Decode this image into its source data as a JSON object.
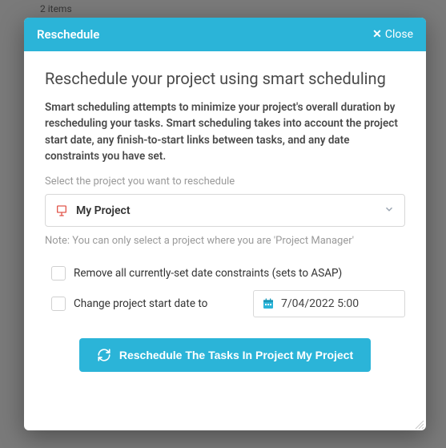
{
  "background": {
    "items_text": "2 items"
  },
  "modal": {
    "header_title": "Reschedule",
    "close_label": "Close",
    "title": "Reschedule your project using smart scheduling",
    "description": "Smart scheduling attempts to minimize your project's overall duration by rescheduling your tasks. Smart scheduling takes into account the project start date, any finish-to-start links between tasks, and any date constraints you have set.",
    "select_label": "Select the project you want to reschedule",
    "project": {
      "name": "My Project"
    },
    "note": "Note: You can only select a project where you are 'Project Manager'",
    "checkbox_remove_constraints": "Remove all currently-set date constraints (sets to ASAP)",
    "checkbox_change_start": "Change project start date to",
    "date_value": "7/04/2022 5:00",
    "action_button": "Reschedule The Tasks In Project My Project"
  }
}
